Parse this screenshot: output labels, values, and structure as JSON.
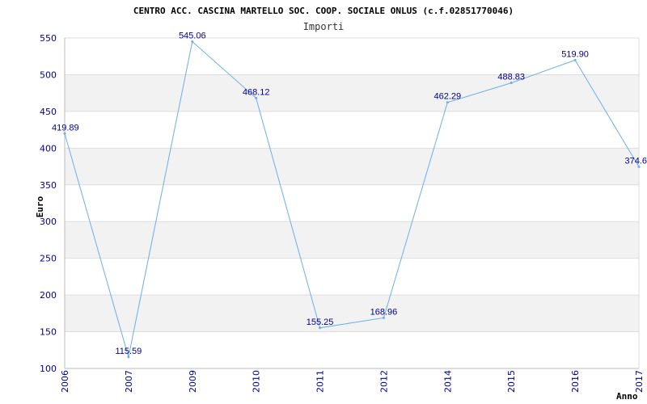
{
  "chart_data": {
    "type": "line",
    "title": "CENTRO ACC. CASCINA MARTELLO SOC. COOP. SOCIALE ONLUS (c.f.02851770046)",
    "subtitle": "Importi",
    "xlabel": "Anno",
    "ylabel": "Euro",
    "categories": [
      "2006",
      "2007",
      "2009",
      "2010",
      "2011",
      "2012",
      "2014",
      "2015",
      "2016",
      "2017"
    ],
    "series": [
      {
        "values": [
          419.89,
          115.59,
          545.06,
          468.12,
          155.25,
          168.96,
          462.29,
          488.83,
          519.9,
          374.6
        ],
        "labels": [
          "419.89",
          "115.59",
          "545.06",
          "468.12",
          "155.25",
          "168.96",
          "462.29",
          "488.83",
          "519.90",
          "374.6"
        ]
      }
    ],
    "ylim": [
      100,
      550
    ],
    "yticks": [
      100,
      150,
      200,
      250,
      300,
      350,
      400,
      450,
      500,
      550
    ],
    "grid": true,
    "colors": {
      "line": "#6aaee8",
      "band": "#f2f2f2",
      "grid": "#dddddd",
      "axis_text": "#00008b"
    }
  }
}
